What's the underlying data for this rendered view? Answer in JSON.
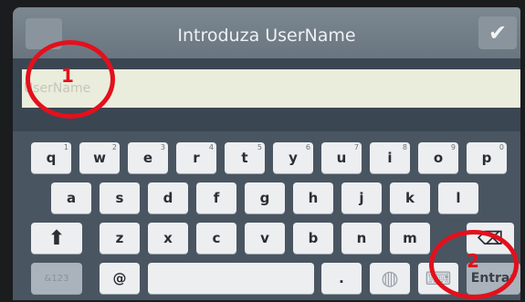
{
  "dialog": {
    "title": "Introduza UserName",
    "confirm_glyph": "✔",
    "input_placeholder": "UserName"
  },
  "keyboard": {
    "row1": [
      {
        "label": "q",
        "num": "1"
      },
      {
        "label": "w",
        "num": "2"
      },
      {
        "label": "e",
        "num": "3"
      },
      {
        "label": "r",
        "num": "4"
      },
      {
        "label": "t",
        "num": "5"
      },
      {
        "label": "y",
        "num": "6"
      },
      {
        "label": "u",
        "num": "7"
      },
      {
        "label": "i",
        "num": "8"
      },
      {
        "label": "o",
        "num": "9"
      },
      {
        "label": "p",
        "num": "0"
      }
    ],
    "row2": [
      "a",
      "s",
      "d",
      "f",
      "g",
      "h",
      "j",
      "k",
      "l"
    ],
    "row3": [
      "z",
      "x",
      "c",
      "v",
      "b",
      "n",
      "m"
    ],
    "shift_glyph": "⬆",
    "backspace_glyph": "⌫",
    "symbols_label": "&123",
    "at_label": "@",
    "dot_label": ".",
    "globe_glyph": "◍",
    "keyboard_glyph": "⌨",
    "enter_label": "Entrar"
  },
  "annotations": {
    "marker1": "1",
    "marker2": "2"
  },
  "colors": {
    "marker": "#e3101c",
    "input_background": "#eaeddc",
    "keyboard_background": "#4a5562"
  }
}
